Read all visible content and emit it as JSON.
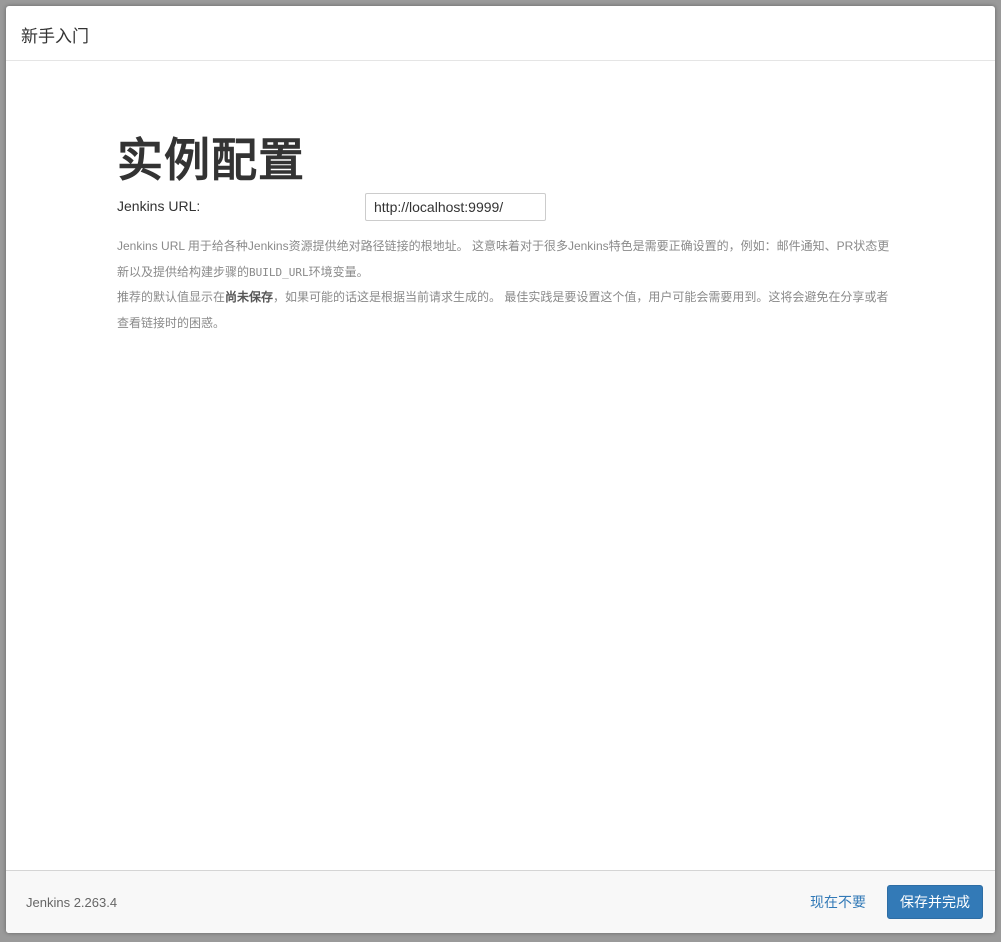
{
  "header": {
    "title": "新手入门"
  },
  "main": {
    "heading": "实例配置",
    "url_field": {
      "label": "Jenkins URL:",
      "value": "http://localhost:9999/"
    },
    "help": {
      "p1_text": "Jenkins URL 用于给各种Jenkins资源提供绝对路径链接的根地址。 这意味着对于很多Jenkins特色是需要正确设置的，例如：邮件通知、PR状态更新以及提供给构建步骤的",
      "p1_code": "BUILD_URL",
      "p1_end": "环境变量。",
      "p2_start": "推荐的默认值显示在",
      "p2_strong": "尚未保存",
      "p2_end": "，如果可能的话这是根据当前请求生成的。 最佳实践是要设置这个值，用户可能会需要用到。这将会避免在分享或者查看链接时的困惑。"
    }
  },
  "footer": {
    "version": "Jenkins 2.263.4",
    "skip_label": "现在不要",
    "save_label": "保存并完成"
  },
  "colors": {
    "primary": "#337ab7",
    "link": "#337ab7",
    "overlay": "#9a9a9a"
  }
}
